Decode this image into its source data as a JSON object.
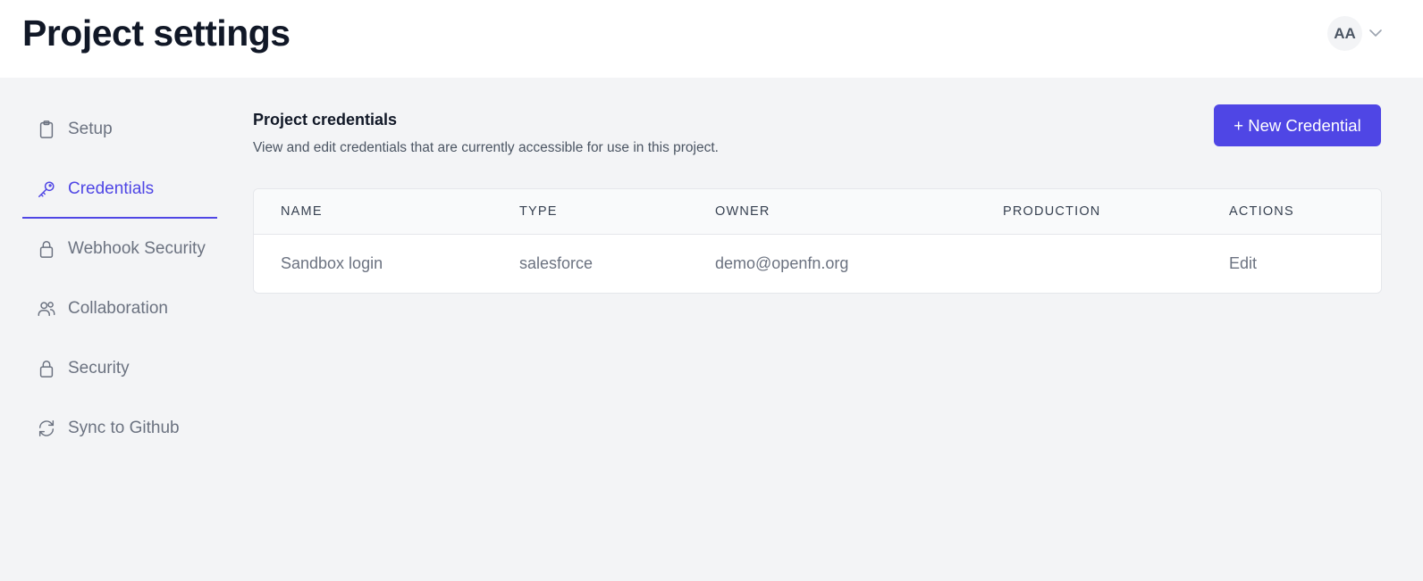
{
  "header": {
    "title": "Project settings",
    "user_initials": "AA",
    "user_menu_icon": "chevron-down-icon"
  },
  "sidebar": {
    "items": [
      {
        "label": "Setup",
        "icon": "clipboard-icon",
        "active": false
      },
      {
        "label": "Credentials",
        "icon": "key-icon",
        "active": true
      },
      {
        "label": "Webhook Security",
        "icon": "lock-icon",
        "active": false
      },
      {
        "label": "Collaboration",
        "icon": "users-icon",
        "active": false
      },
      {
        "label": "Security",
        "icon": "lock-icon",
        "active": false
      },
      {
        "label": "Sync to Github",
        "icon": "sync-icon",
        "active": false
      }
    ]
  },
  "main": {
    "title": "Project credentials",
    "description": "View and edit credentials that are currently accessible for use in this project.",
    "new_button_label": "+ New Credential",
    "table": {
      "headers": [
        "Name",
        "Type",
        "Owner",
        "Production",
        "Actions"
      ],
      "rows": [
        {
          "name": "Sandbox login",
          "type": "salesforce",
          "owner": "demo@openfn.org",
          "production": "",
          "action": "Edit"
        }
      ]
    }
  },
  "colors": {
    "accent": "#4f46e5",
    "page_background": "#f3f4f6",
    "header_background": "#ffffff",
    "muted_text": "#6b7280"
  }
}
